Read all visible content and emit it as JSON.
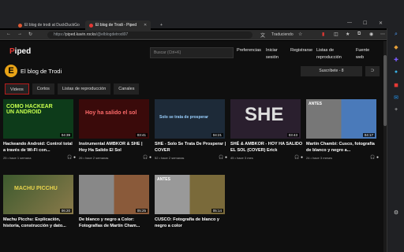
{
  "browser": {
    "tabs": [
      {
        "label": "El blog de trodi at DuckDuckGo",
        "fav_color": "#de5833"
      },
      {
        "label": "El blog de Trodi - Piped",
        "fav_color": "#e53935"
      }
    ],
    "new_tab": "+",
    "url_prefix": "https://",
    "url_host": "piped.kavin.rocks",
    "url_path": "/@elblogdetrodi97",
    "translating": "Traduciendo"
  },
  "piped": {
    "logo_letter": "P",
    "logo_rest": "iped",
    "search_placeholder": "Buscar (Ctrl+K)",
    "nav": [
      "Preferencias",
      "Iniciar sesión",
      "Registrarse",
      "Listas de reproducción",
      "Fuente web"
    ],
    "channel": {
      "avatar": "E",
      "name": "El blog de Trodi",
      "subscribe": "Suscríbete - 8"
    },
    "tabs": [
      "Videos",
      "Cortos",
      "Listas de reproducción",
      "Canales"
    ]
  },
  "videos": [
    {
      "title": "Hackeando Android: Control total a través de Wi-Fi con...",
      "duration": "04:39",
      "meta": "25 • hace 1 semana",
      "thumb_text": "COMO HACKEAR UN ANDROID",
      "bg": "#0d3b1a"
    },
    {
      "title": "Instrumental AMBKOR & SHE | Hoy Ha Salido El Sol",
      "duration": "03:41",
      "meta": "26 • hace 2 semanas",
      "thumb_text": "Hoy ha salido el sol",
      "bg": "#3a0a0a"
    },
    {
      "title": "SHE - Solo Se Trata De Prosperar | COVER",
      "duration": "04:21",
      "meta": "52 • hace 2 semanas",
      "thumb_text": "Solo se trata de prosperar",
      "bg": "#1d2a38"
    },
    {
      "title": "SHÉ & AMBKOR - HOY HA SALIDO EL SOL (COVER) Erick",
      "duration": "03:43",
      "meta": "45 • hace 3 mes",
      "thumb_text": "SHE",
      "bg": "#2a1f2e"
    },
    {
      "title": "Martín Chambi: Cusco, fotografía de blanco y negro a...",
      "duration": "04:17",
      "meta": "24 • hace 3 meses",
      "thumb_text": "ANTES",
      "bg": "#4a5b7a"
    },
    {
      "title": "Machu Picchu: Explicación, historia, construcción y dato...",
      "duration": "06:20",
      "meta": "",
      "thumb_text": "MACHU PICCHU",
      "bg": "#3d5a2e"
    },
    {
      "title": "De blanco y negro a Color: Fotografías de Martín Cham...",
      "duration": "05:25",
      "meta": "",
      "thumb_text": "",
      "bg": "#5a4a3a"
    },
    {
      "title": "CUSCO: Fotografía de blanco y negro a color",
      "duration": "05:14",
      "meta": "",
      "thumb_text": "ANTES",
      "bg": "#6a5a4a"
    }
  ]
}
